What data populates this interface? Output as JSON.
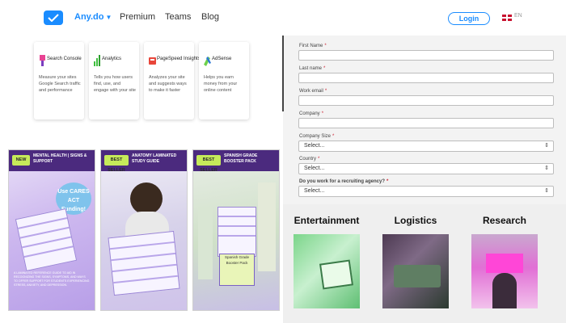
{
  "nav": {
    "brand": "Any.do",
    "items": [
      "Premium",
      "Teams",
      "Blog"
    ],
    "login": "Login",
    "lang": "EN"
  },
  "cards": [
    {
      "title": "Search Console",
      "desc": "Measure your sites Google Search traffic and performance",
      "icon": "search-console-icon",
      "color": "#e84393"
    },
    {
      "title": "Analytics",
      "desc": "Tells you how users find, use, and engage with your site",
      "icon": "analytics-bars-icon",
      "color": "#3fbf3f"
    },
    {
      "title": "PageSpeed Insights",
      "desc": "Analyzes your site and suggests ways to make it faster",
      "icon": "pagespeed-icon",
      "color": "#e8463a"
    },
    {
      "title": "AdSense",
      "desc": "Helps you earn money from your online content",
      "icon": "adsense-icon",
      "color": "#6ed14c"
    }
  ],
  "products": [
    {
      "badge": "NEW",
      "header": "MENTAL HEALTH | SIGNS & SUPPORT",
      "callout": "Use CARES ACT Funding!",
      "desc": "A LAMINATED REFERENCE GUIDE TO AID IN RECOGNIZING THE SIGNS, SYMPTOMS, AND WAYS TO OFFER SUPPORT FOR STUDENTS EXPERIENCING STRESS, ANXIETY, AND DEPRESSION."
    },
    {
      "badge": "BEST SELLER",
      "header": "ANATOMY LAMINATED STUDY GUIDE"
    },
    {
      "badge": "BEST SELLER",
      "header": "SPANISH GRADE BOOSTER PACK",
      "cover": "Spanish Grade Booster Pack"
    }
  ],
  "form": {
    "fields": [
      {
        "label": "First Name",
        "required": "*"
      },
      {
        "label": "Last name",
        "required": "*"
      },
      {
        "label": "Work email",
        "required": "*"
      },
      {
        "label": "Company",
        "required": "*"
      }
    ],
    "selects": [
      {
        "label": "Company Size",
        "required": "*",
        "value": "Select..."
      },
      {
        "label": "Country",
        "required": "*",
        "value": "Select..."
      },
      {
        "label": "Do you work for a recruiting agency?",
        "required": "*",
        "value": "Select..."
      }
    ]
  },
  "categories": [
    "Entertainment",
    "Logistics",
    "Research"
  ],
  "colors": {
    "accent": "#1a8cff",
    "product_header": "#4b2a7e",
    "badge": "#c6ea5a"
  }
}
